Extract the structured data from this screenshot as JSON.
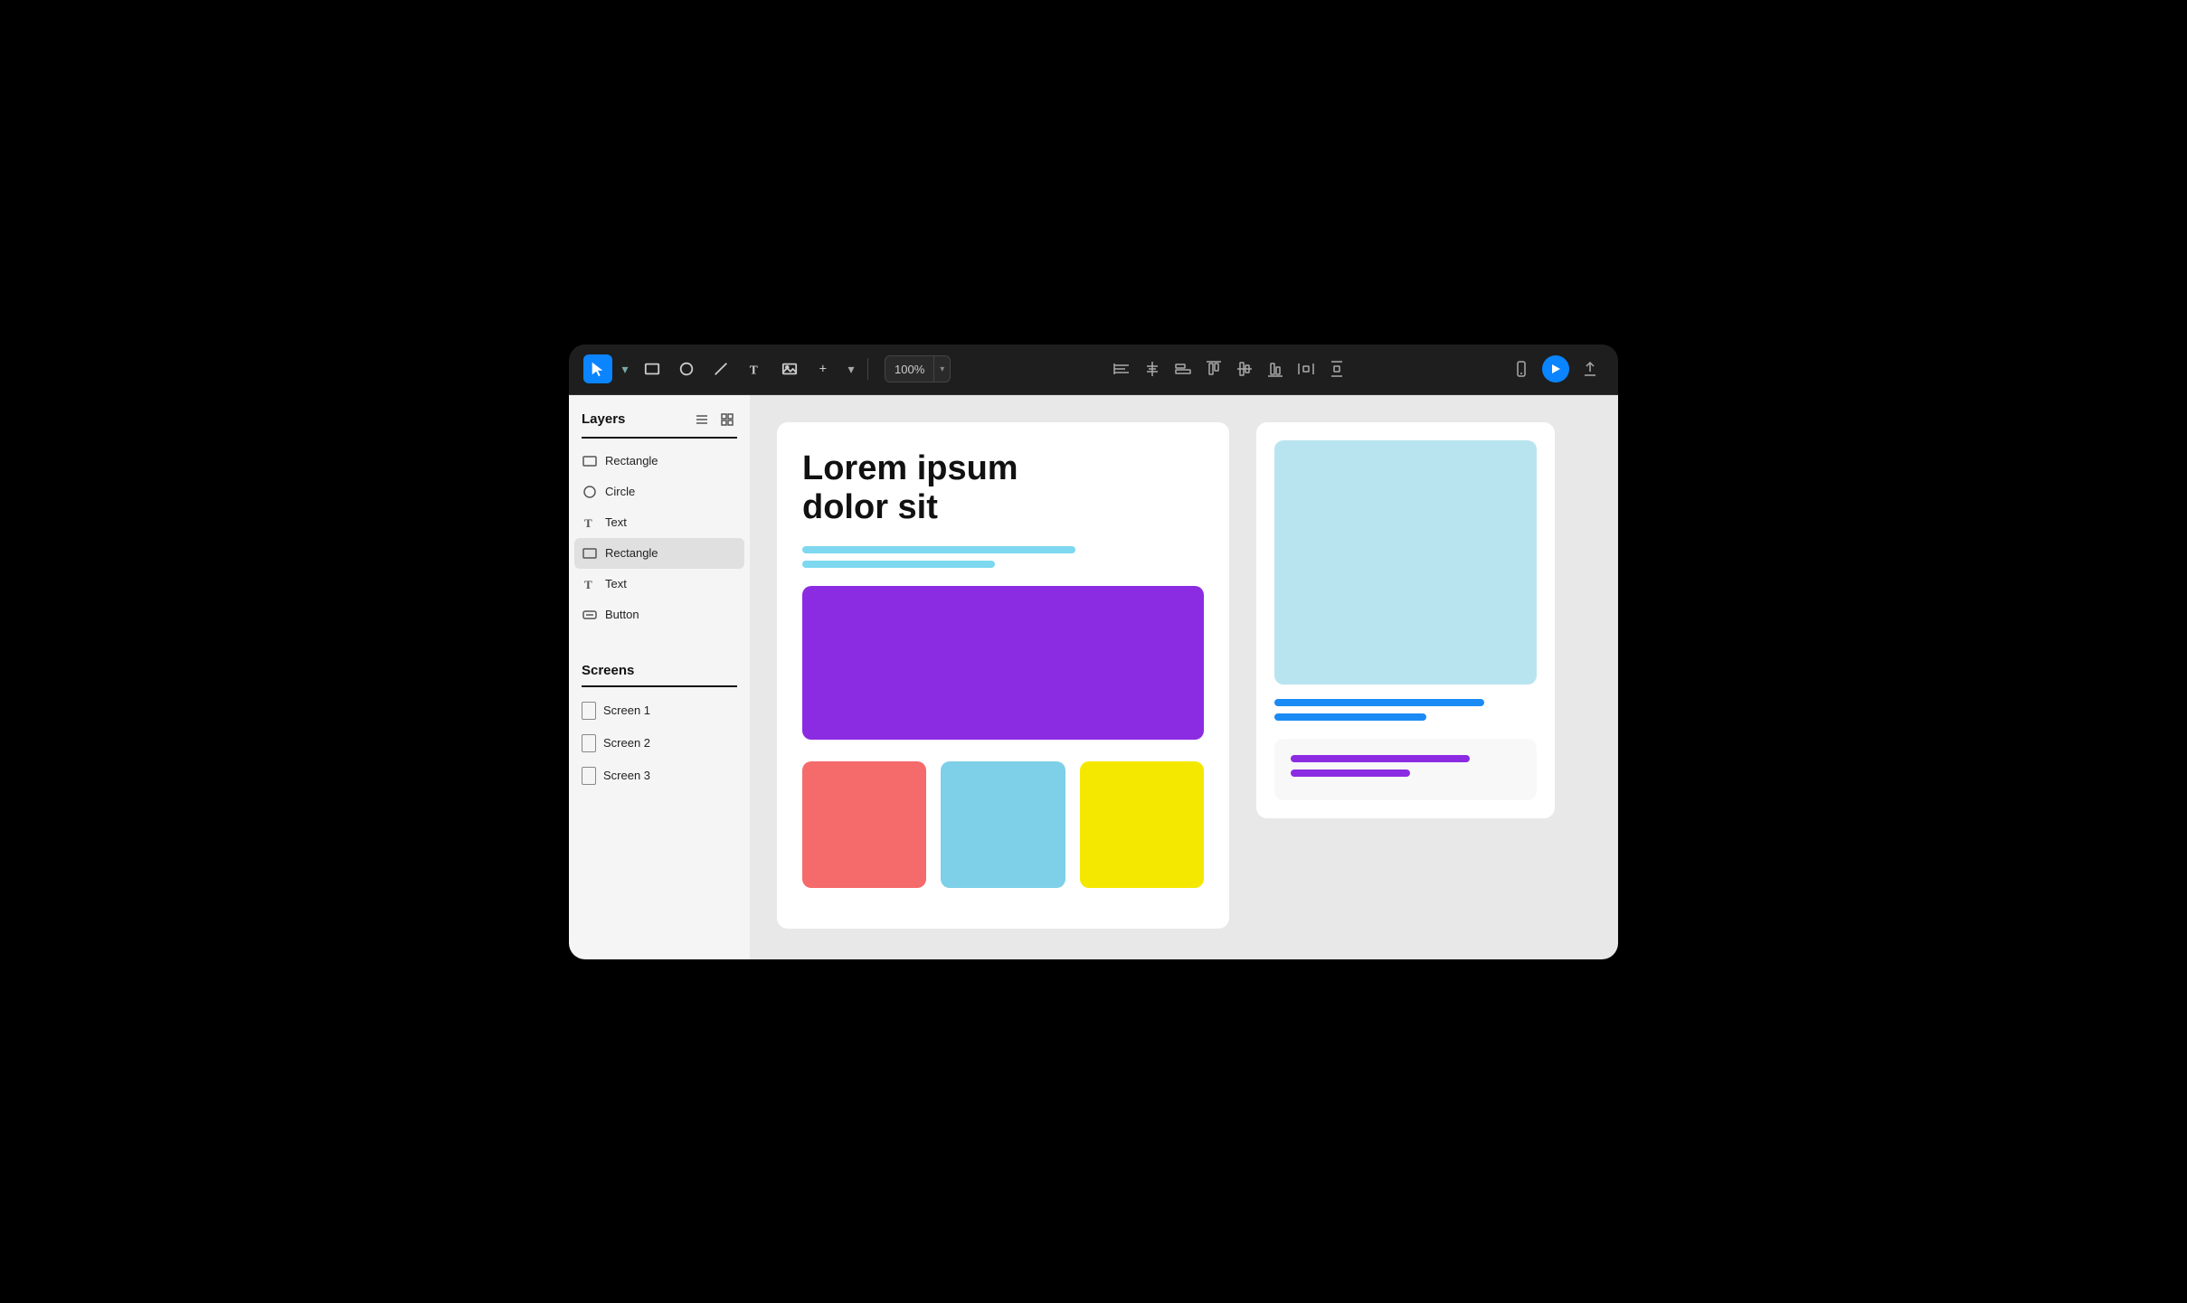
{
  "toolbar": {
    "zoom_value": "100%",
    "zoom_arrow": "▾"
  },
  "sidebar": {
    "layers_title": "Layers",
    "layers": [
      {
        "name": "Rectangle",
        "type": "rectangle",
        "active": false
      },
      {
        "name": "Circle",
        "type": "circle",
        "active": false
      },
      {
        "name": "Text",
        "type": "text",
        "active": false
      },
      {
        "name": "Rectangle",
        "type": "rectangle",
        "active": true
      },
      {
        "name": "Text",
        "type": "text",
        "active": false
      },
      {
        "name": "Button",
        "type": "button",
        "active": false
      }
    ],
    "screens_title": "Screens",
    "screens": [
      {
        "name": "Screen 1"
      },
      {
        "name": "Screen 2"
      },
      {
        "name": "Screen 3"
      }
    ]
  },
  "canvas": {
    "main_frame": {
      "title_line1": "Lorem ipsum",
      "title_line2": "dolor sit",
      "placeholder_line1_color": "#7dd8f0",
      "placeholder_line1_width": "68%",
      "placeholder_line2_color": "#7dd8f0",
      "placeholder_line2_width": "48%",
      "purple_rect_color": "#8b2be2",
      "color_boxes": [
        {
          "color": "#f56b6b"
        },
        {
          "color": "#7ecfe8"
        },
        {
          "color": "#f5e800"
        }
      ]
    },
    "right_frame": {
      "image_bg": "#b8e4f0",
      "blue_line1_color": "#1a8af5",
      "blue_line1_width": "80%",
      "blue_line2_color": "#1a8af5",
      "blue_line2_width": "58%",
      "purple_line1_color": "#8b2be2",
      "purple_line1_width": "78%",
      "purple_line2_color": "#8b2be2",
      "purple_line2_width": "52%"
    }
  }
}
